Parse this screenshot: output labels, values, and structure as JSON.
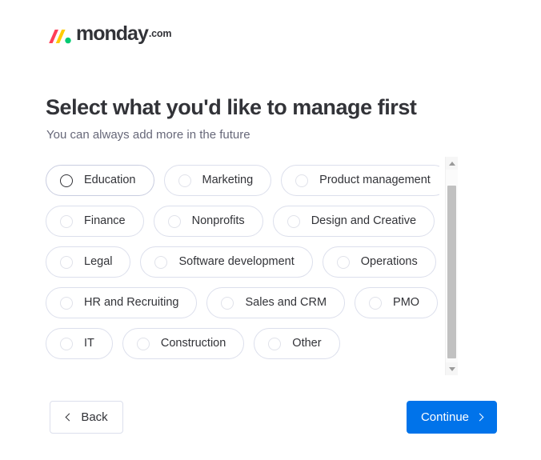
{
  "brand": {
    "name": "monday",
    "tld": ".com",
    "colors": {
      "bar_pink": "#ff3d57",
      "bar_yellow": "#ffcb00",
      "dot_green": "#00ca72",
      "accent_blue": "#0073ea",
      "text_dark": "#323338",
      "text_muted": "#676879",
      "border": "#dcdfec"
    }
  },
  "header": {
    "title": "Select what you'd like to manage first",
    "subtitle": "You can always add more in the future"
  },
  "options": {
    "rows": [
      [
        {
          "label": "Education",
          "selected": false,
          "hovered": true
        },
        {
          "label": "Marketing",
          "selected": false,
          "hovered": false
        },
        {
          "label": "Product management",
          "selected": false,
          "hovered": false
        }
      ],
      [
        {
          "label": "Finance",
          "selected": false,
          "hovered": false
        },
        {
          "label": "Nonprofits",
          "selected": false,
          "hovered": false
        },
        {
          "label": "Design and Creative",
          "selected": false,
          "hovered": false
        }
      ],
      [
        {
          "label": "Legal",
          "selected": false,
          "hovered": false
        },
        {
          "label": "Software development",
          "selected": false,
          "hovered": false
        },
        {
          "label": "Operations",
          "selected": false,
          "hovered": false
        }
      ],
      [
        {
          "label": "HR and Recruiting",
          "selected": false,
          "hovered": false
        },
        {
          "label": "Sales and CRM",
          "selected": false,
          "hovered": false
        },
        {
          "label": "PMO",
          "selected": false,
          "hovered": false
        }
      ],
      [
        {
          "label": "IT",
          "selected": false,
          "hovered": false
        },
        {
          "label": "Construction",
          "selected": false,
          "hovered": false
        },
        {
          "label": "Other",
          "selected": false,
          "hovered": false
        }
      ]
    ]
  },
  "scrollbar": {
    "up_icon": "triangle-up-icon",
    "down_icon": "triangle-down-icon",
    "thumb_position_percent": 0,
    "thumb_size_percent": 88
  },
  "footer": {
    "back_label": "Back",
    "back_icon": "chevron-left-icon",
    "continue_label": "Continue",
    "continue_icon": "chevron-right-icon"
  }
}
